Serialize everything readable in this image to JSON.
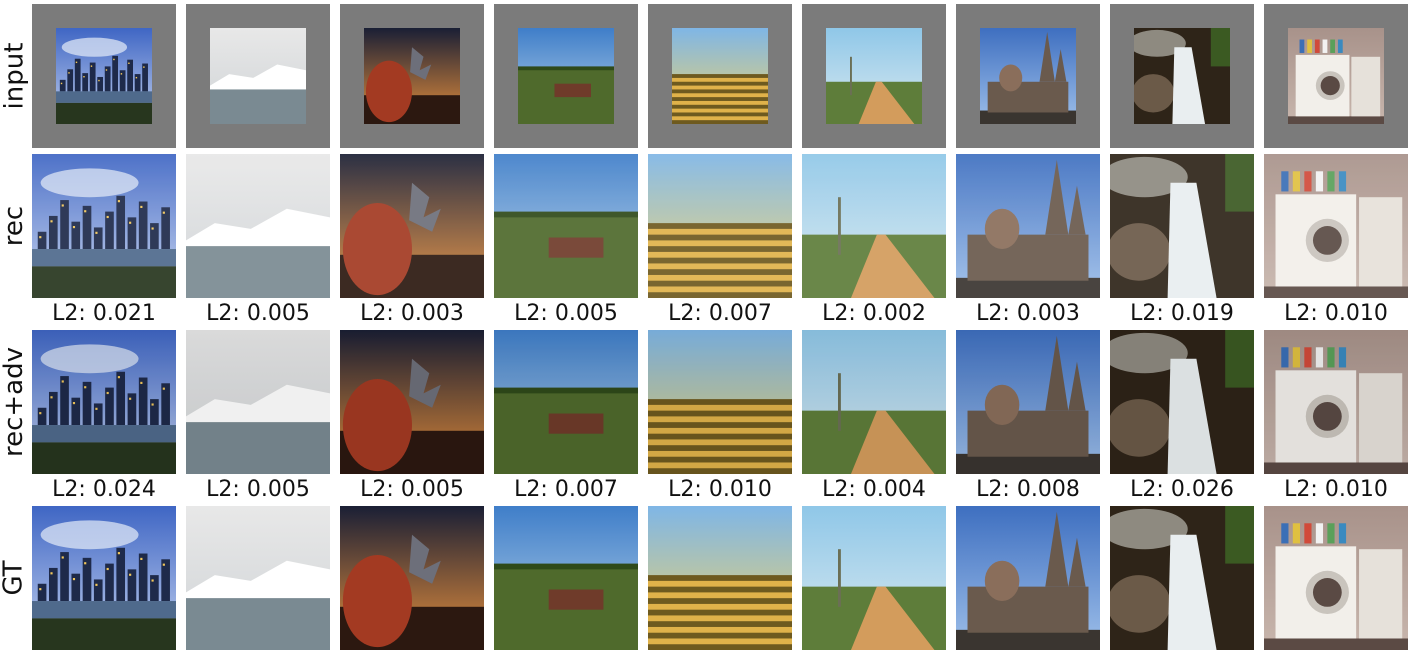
{
  "rows": [
    {
      "label": "input",
      "padded": true
    },
    {
      "label": "rec",
      "padded": false
    },
    {
      "label": "rec+adv",
      "padded": false
    },
    {
      "label": "GT",
      "padded": false
    }
  ],
  "scenes": [
    {
      "name": "city-skyline-at-dusk",
      "sky_top": "#3f66c4",
      "sky_bottom": "#c4d2ef",
      "ground": "#27361e",
      "accent": "#f2c75a",
      "motif": "city"
    },
    {
      "name": "glacier-and-fog",
      "sky_top": "#e8e8e8",
      "sky_bottom": "#cfd3d6",
      "ground": "#7a8a92",
      "accent": "#ffffff",
      "motif": "glacier"
    },
    {
      "name": "autumn-tree-sunset",
      "sky_top": "#1a1f35",
      "sky_bottom": "#e9913c",
      "ground": "#2c1810",
      "accent": "#a33a22",
      "motif": "tree"
    },
    {
      "name": "green-field-ruin",
      "sky_top": "#3f7ec9",
      "sky_bottom": "#bcd6ea",
      "ground": "#4f6a2c",
      "accent": "#6f3b2a",
      "motif": "field"
    },
    {
      "name": "golden-farmland",
      "sky_top": "#7fb6e6",
      "sky_bottom": "#f1d46a",
      "ground": "#6e5a1f",
      "accent": "#e0b24a",
      "motif": "farm"
    },
    {
      "name": "dirt-road-countryside",
      "sky_top": "#8fc7e8",
      "sky_bottom": "#dbeaf0",
      "ground": "#5e7d3a",
      "accent": "#d39c5c",
      "motif": "road"
    },
    {
      "name": "gothic-cathedral",
      "sky_top": "#3e6fc0",
      "sky_bottom": "#9fc0ea",
      "ground": "#3a3530",
      "accent": "#6a5a4d",
      "motif": "cathedral"
    },
    {
      "name": "waterfall-rocks",
      "sky_top": "#3a2a1a",
      "sky_bottom": "#6b4a2a",
      "ground": "#2e2418",
      "accent": "#e9eef0",
      "motif": "waterfall"
    },
    {
      "name": "laundry-room-washer",
      "sky_top": "#a8928a",
      "sky_bottom": "#c8b6ad",
      "ground": "#5b4a44",
      "accent": "#f2efea",
      "motif": "washer"
    }
  ],
  "metrics": {
    "rec": [
      "L2: 0.021",
      "L2: 0.005",
      "L2: 0.003",
      "L2: 0.005",
      "L2: 0.007",
      "L2: 0.002",
      "L2: 0.003",
      "L2: 0.019",
      "L2: 0.010"
    ],
    "rec_adv": [
      "L2: 0.024",
      "L2: 0.005",
      "L2: 0.005",
      "L2: 0.007",
      "L2: 0.010",
      "L2: 0.004",
      "L2: 0.008",
      "L2: 0.026",
      "L2: 0.010"
    ]
  }
}
